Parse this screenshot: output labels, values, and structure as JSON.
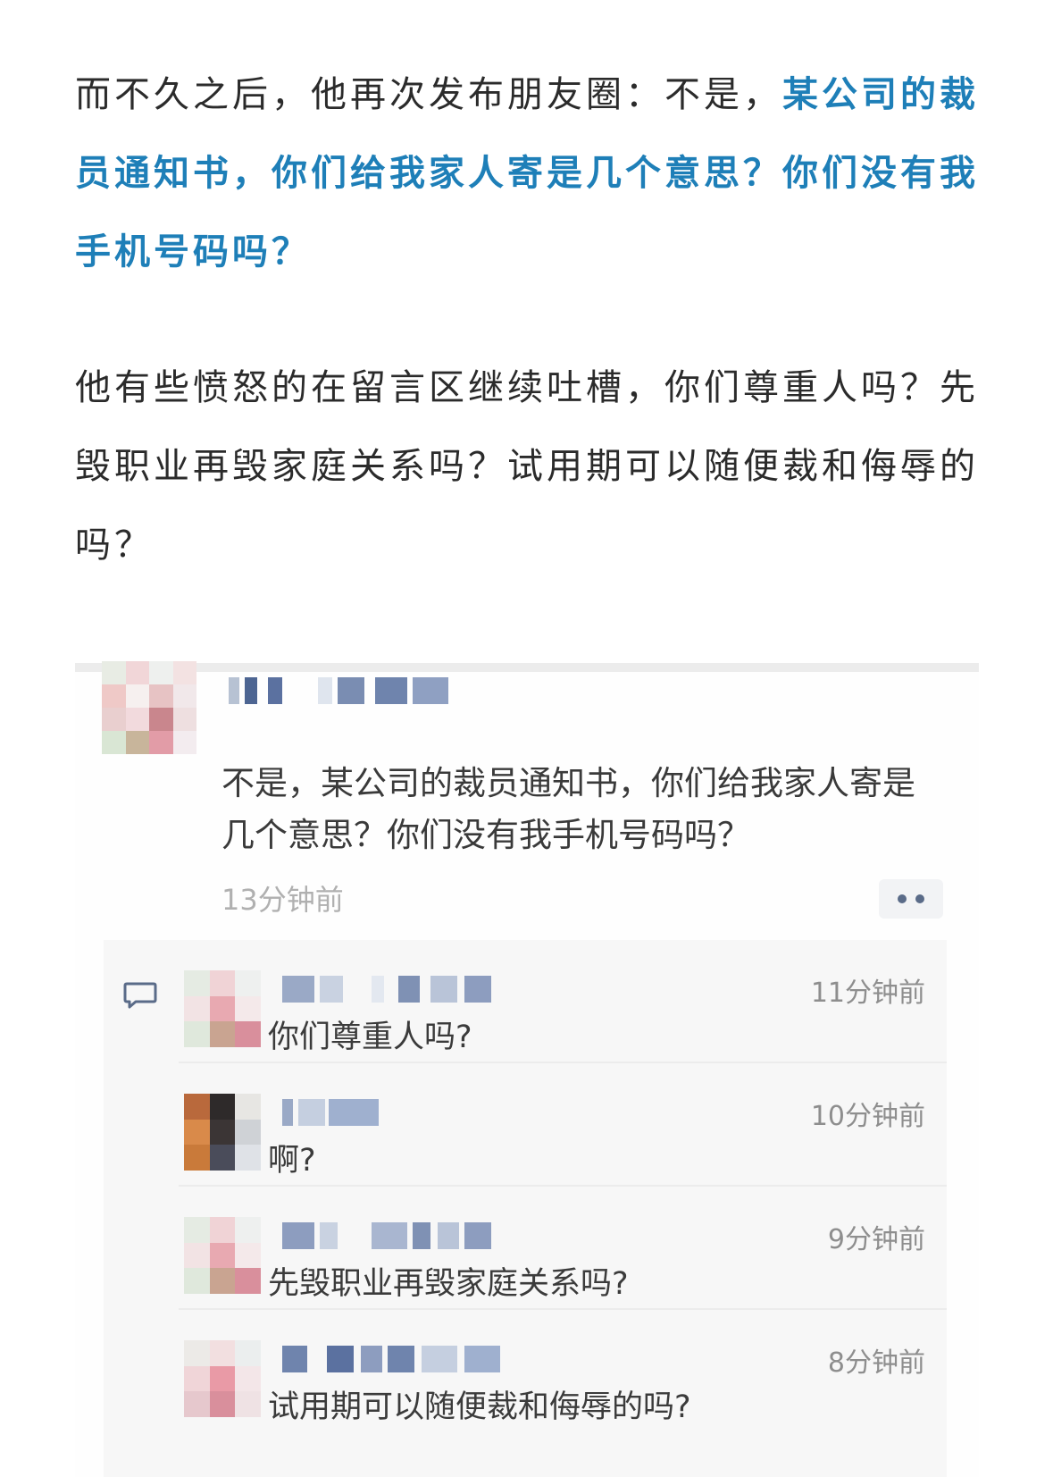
{
  "article": {
    "para1_plain": "而不久之后，他再次发布朋友圈：不是，",
    "para1_highlight": "某公司的裁员通知书，你们给我家人寄是几个意思？你们没有我手机号码吗？",
    "para2": "他有些愤怒的在留言区继续吐槽，你们尊重人吗？先毁职业再毁家庭关系吗？试用期可以随便裁和侮辱的吗？"
  },
  "post": {
    "text": "不是，某公司的裁员通知书，你们给我家人寄是几个意思？你们没有我手机号码吗？",
    "time": "13分钟前",
    "more_icon": "more-dots-icon"
  },
  "comments": {
    "icon": "comment-bubble-icon",
    "items": [
      {
        "text": "你们尊重人吗?",
        "time": "11分钟前"
      },
      {
        "text": "啊?",
        "time": "10分钟前"
      },
      {
        "text": "先毁职业再毁家庭关系吗?",
        "time": "9分钟前"
      },
      {
        "text": "试用期可以随便裁和侮辱的吗?",
        "time": "8分钟前"
      }
    ]
  },
  "colors": {
    "highlight": "#1e7fb8",
    "text": "#2b2b2b",
    "muted": "#b0b0b0",
    "comment_bg": "#f7f7f7"
  }
}
